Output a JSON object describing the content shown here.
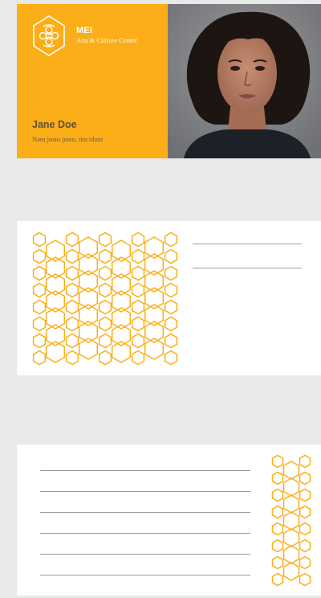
{
  "brand": {
    "name": "MEI",
    "subtitle": "Arts & Culture Center",
    "accent_color": "#fbae17",
    "logo_icon": "hexagon-knot-logo-icon"
  },
  "person": {
    "name": "Jane Doe",
    "title": "Nam justo justo, tincidunt"
  },
  "cards": [
    {
      "role": "front",
      "content": "logo, name, title, portrait photo"
    },
    {
      "role": "back-letterhead",
      "blank_lines": 2,
      "pattern_icon": "honeycomb-pattern-icon"
    },
    {
      "role": "back-notes",
      "blank_lines": 6,
      "pattern_icon": "honeycomb-strip-icon"
    }
  ]
}
